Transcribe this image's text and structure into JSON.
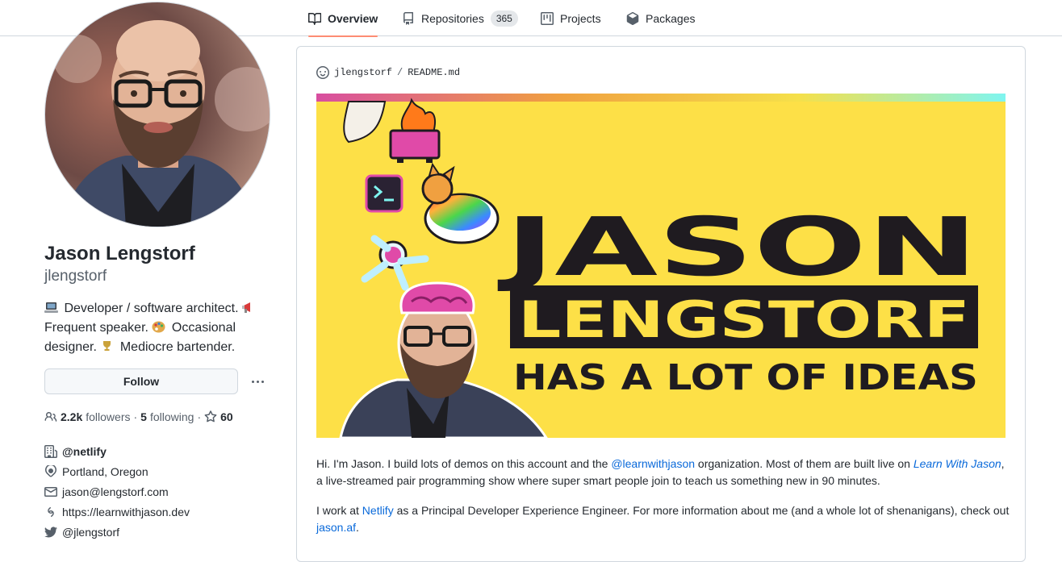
{
  "tabs": [
    {
      "label": "Overview",
      "icon": "book-icon",
      "selected": true
    },
    {
      "label": "Repositories",
      "icon": "repo-icon",
      "count": "365"
    },
    {
      "label": "Projects",
      "icon": "project-icon"
    },
    {
      "label": "Packages",
      "icon": "package-icon"
    }
  ],
  "profile": {
    "name": "Jason Lengstorf",
    "login": "jlengstorf",
    "bio": {
      "part1": "Developer / software architect.",
      "part2": "Frequent speaker.",
      "part3": "Occasional designer.",
      "part4": "Mediocre bartender."
    },
    "follow_label": "Follow",
    "followers_count": "2.2k",
    "followers_label": "followers",
    "following_count": "5",
    "following_label": "following",
    "stars_count": "60",
    "organization": "@netlify",
    "location": "Portland, Oregon",
    "email": "jason@lengstorf.com",
    "website": "https://learnwithjason.dev",
    "twitter": "@jlengstorf"
  },
  "readme": {
    "owner": "jlengstorf",
    "separator": "/",
    "file": "README.md",
    "banner": {
      "line1": "JASON",
      "line2": "LENGSTORF",
      "line3": "HAS A LOT OF IDEAS",
      "bg_color": "#fde047",
      "text_color": "#1f1b20"
    },
    "p1": {
      "t1": "Hi. I'm Jason. I build lots of demos on this account and the ",
      "link1": "@learnwithjason",
      "t2": " organization. Most of them are built live on ",
      "link2": "Learn With Jason",
      "t3": ",",
      "t4": "a live-streamed pair programming show where super smart people join to teach us something new in 90 minutes."
    },
    "p2": {
      "t1": "I work at ",
      "link1": "Netlify",
      "t2": " as a Principal Developer Experience Engineer. For more information about me (and a whole lot of shenanigans), check out",
      "link2": "jason.af",
      "t3": "."
    }
  },
  "colors": {
    "accent_tab": "#fd8c73",
    "link": "#0969da",
    "border": "#d0d7de"
  }
}
